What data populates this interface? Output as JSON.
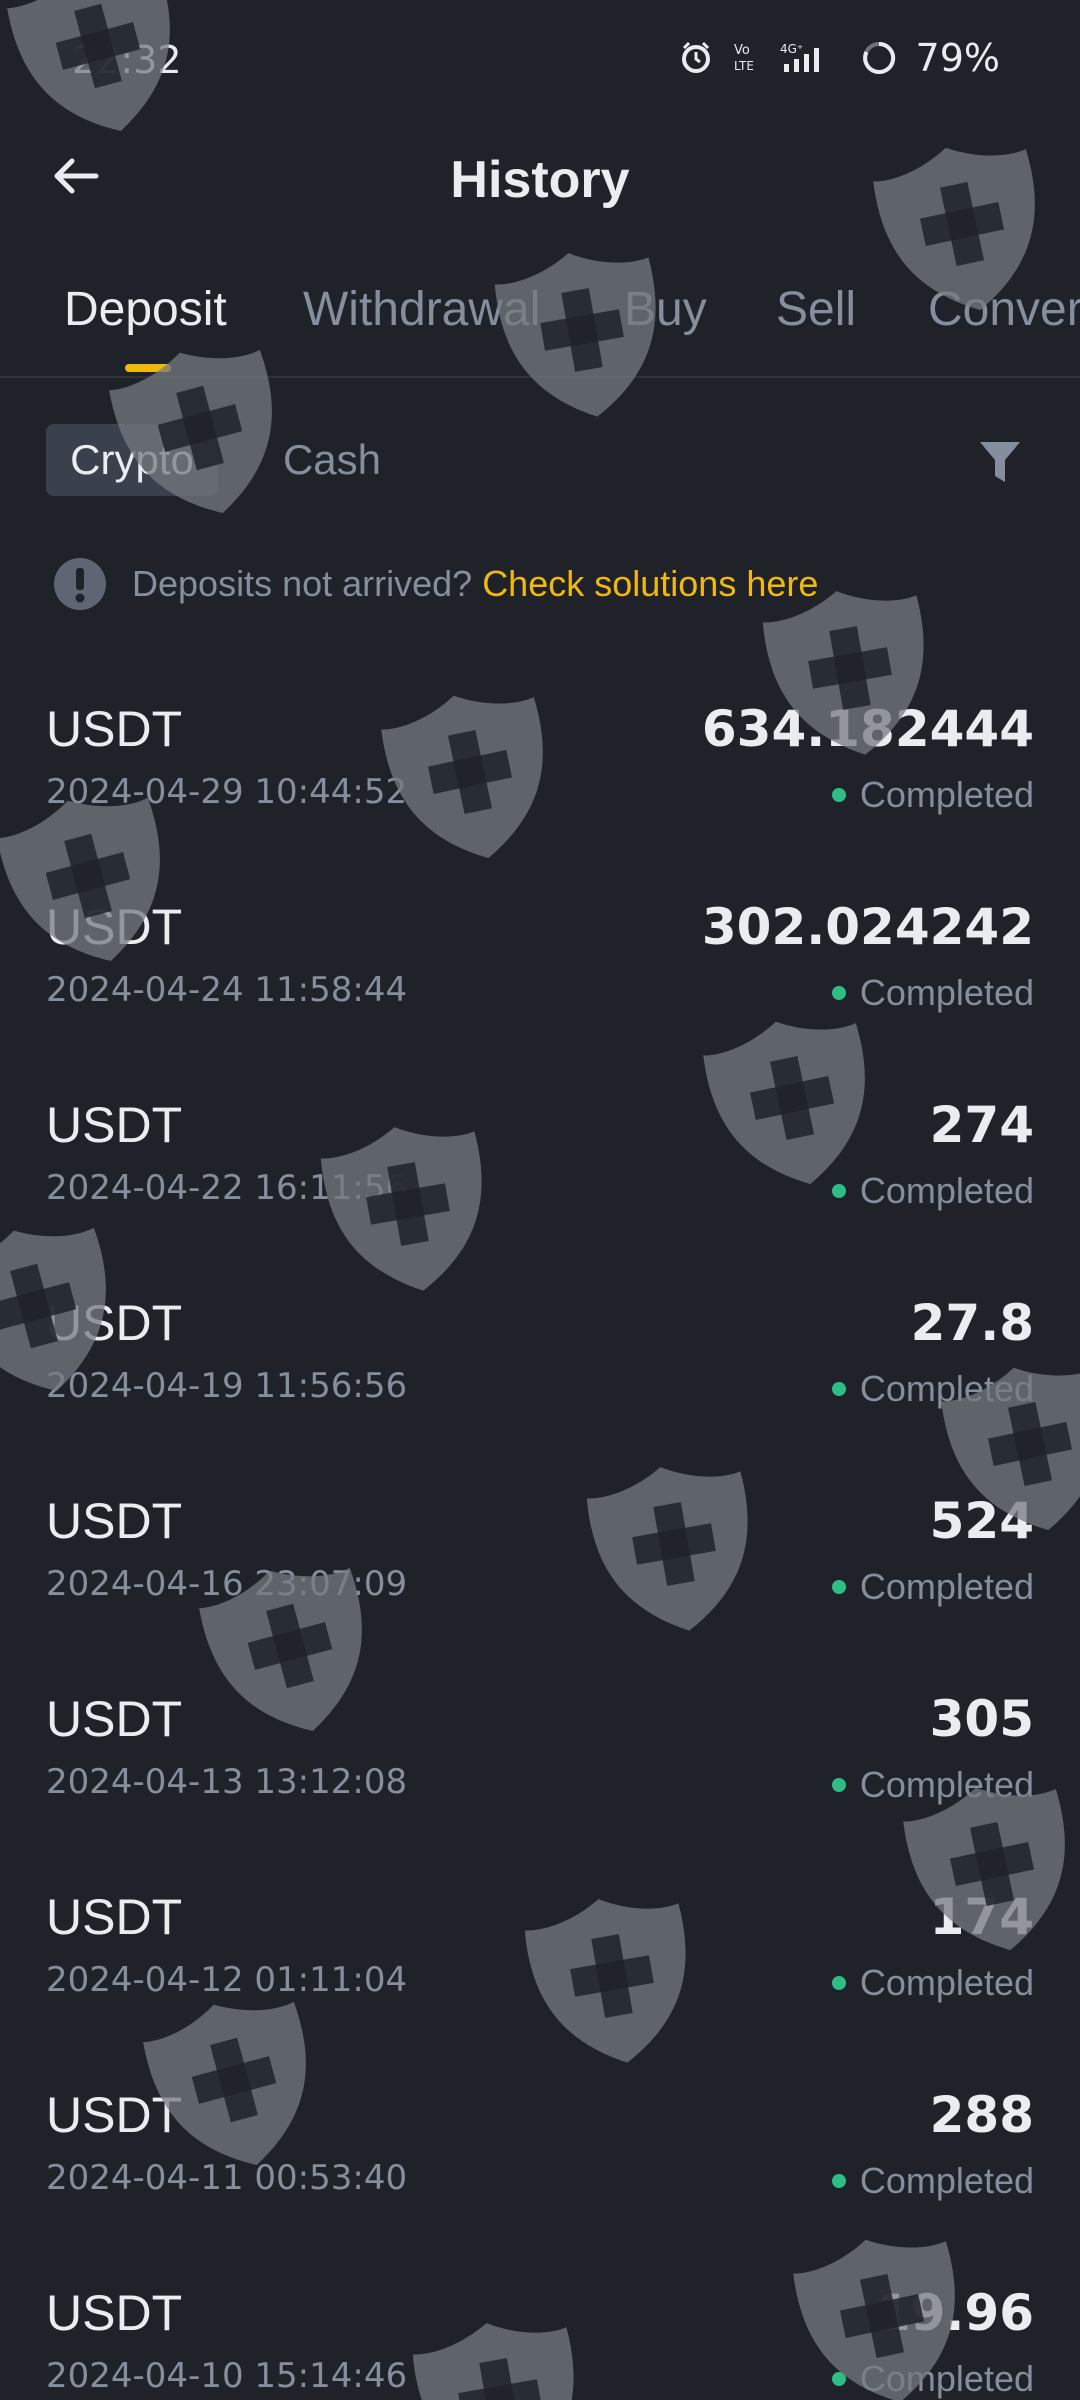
{
  "status_bar": {
    "time": "22:32",
    "battery": "79%",
    "icons": [
      "alarm-icon",
      "volte-icon",
      "signal-4g-icon",
      "battery-icon"
    ]
  },
  "header": {
    "title": "History",
    "back_icon": "arrow-left-icon"
  },
  "tabs": [
    {
      "label": "Deposit",
      "active": true
    },
    {
      "label": "Withdrawal",
      "active": false
    },
    {
      "label": "Buy",
      "active": false
    },
    {
      "label": "Sell",
      "active": false
    },
    {
      "label": "Convert",
      "active": false
    }
  ],
  "segments": {
    "crypto": "Crypto",
    "cash": "Cash",
    "selected": "Crypto"
  },
  "filter_icon": "filter-icon",
  "notice": {
    "icon": "exclamation-icon",
    "text": "Deposits not arrived?",
    "link": "Check solutions here"
  },
  "colors": {
    "background": "#1f2229",
    "accent": "#f0b90b",
    "success": "#2ebd85",
    "text_primary": "#eaecef",
    "text_secondary": "#848e9c"
  },
  "history": [
    {
      "asset": "USDT",
      "date": "2024-04-29 10:44:52",
      "amount": "634.182444",
      "status": "Completed"
    },
    {
      "asset": "USDT",
      "date": "2024-04-24 11:58:44",
      "amount": "302.024242",
      "status": "Completed"
    },
    {
      "asset": "USDT",
      "date": "2024-04-22 16:11:56",
      "amount": "274",
      "status": "Completed"
    },
    {
      "asset": "USDT",
      "date": "2024-04-19 11:56:56",
      "amount": "27.8",
      "status": "Completed"
    },
    {
      "asset": "USDT",
      "date": "2024-04-16 23:07:09",
      "amount": "524",
      "status": "Completed"
    },
    {
      "asset": "USDT",
      "date": "2024-04-13 13:12:08",
      "amount": "305",
      "status": "Completed"
    },
    {
      "asset": "USDT",
      "date": "2024-04-12 01:11:04",
      "amount": "174",
      "status": "Completed"
    },
    {
      "asset": "USDT",
      "date": "2024-04-11 00:53:40",
      "amount": "288",
      "status": "Completed"
    },
    {
      "asset": "USDT",
      "date": "2024-04-10 15:14:46",
      "amount": "19.96",
      "status": "Completed"
    }
  ],
  "watermark_icon": "shield-plus-icon"
}
